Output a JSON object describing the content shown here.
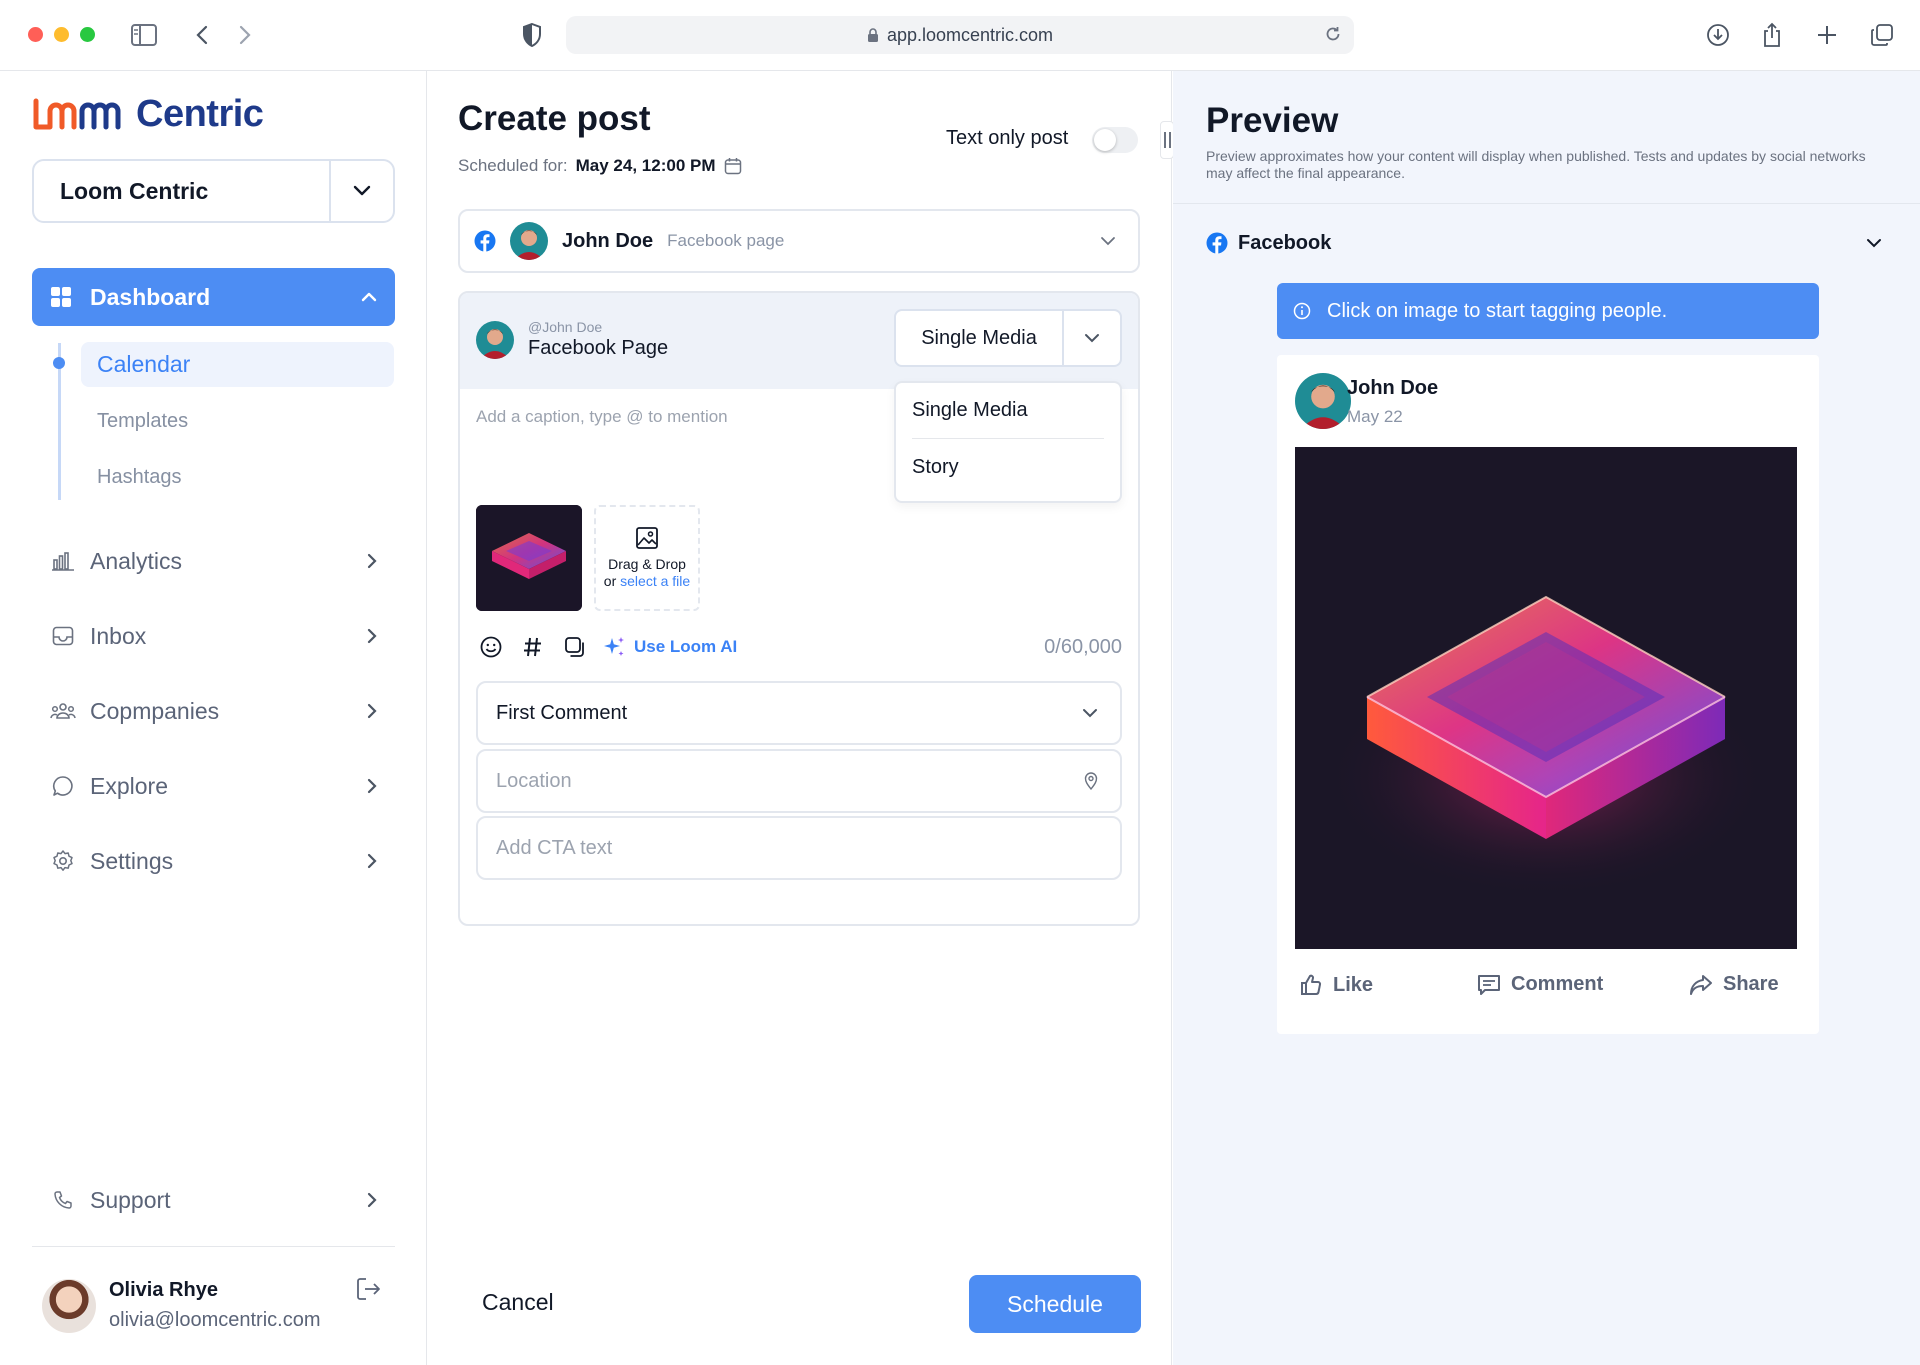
{
  "browser": {
    "url": "app.loomcentric.com"
  },
  "sidebar": {
    "brand": "Centric",
    "workspace": "Loom Centric",
    "dashboard_label": "Dashboard",
    "subitems": [
      "Calendar",
      "Templates",
      "Hashtags"
    ],
    "items": [
      {
        "label": "Analytics",
        "icon": "bar-chart-icon"
      },
      {
        "label": "Inbox",
        "icon": "inbox-icon"
      },
      {
        "label": "Copmpanies",
        "icon": "users-icon"
      },
      {
        "label": "Explore",
        "icon": "chat-bubble-icon"
      },
      {
        "label": "Settings",
        "icon": "gear-icon"
      }
    ],
    "support_label": "Support",
    "user": {
      "name": "Olivia Rhye",
      "email": "olivia@loomcentric.com"
    }
  },
  "composer": {
    "title": "Create post",
    "scheduled_label": "Scheduled for:",
    "scheduled_value": "May 24, 12:00 PM",
    "text_only_label": "Text only post",
    "text_only_on": false,
    "account": {
      "name": "John Doe",
      "type": "Facebook page"
    },
    "card": {
      "handle": "@John Doe",
      "page_name": "Facebook Page",
      "media_type": "Single Media",
      "media_options": [
        "Single Media",
        "Story"
      ],
      "caption_placeholder": "Add a caption, type @ to mention",
      "dropzone_line1": "Drag & Drop",
      "dropzone_or": "or",
      "dropzone_link": "select a file",
      "ai_label": "Use Loom AI",
      "char_count": "0/60,000",
      "first_comment": "First Comment",
      "location_placeholder": "Location",
      "cta_placeholder": "Add CTA text"
    },
    "cancel_label": "Cancel",
    "schedule_label": "Schedule"
  },
  "preview": {
    "title": "Preview",
    "description": "Preview approximates how your content will display when published. Tests and updates by social networks may affect the final appearance.",
    "network": "Facebook",
    "banner": "Click on image to start tagging people.",
    "post": {
      "name": "John Doe",
      "date": "May 22"
    },
    "actions": [
      "Like",
      "Comment",
      "Share"
    ]
  },
  "colors": {
    "accent": "#4d8df3",
    "facebook": "#1877f2",
    "brand_dark": "#1e3a8a",
    "brand_orange": "#f05a28"
  }
}
